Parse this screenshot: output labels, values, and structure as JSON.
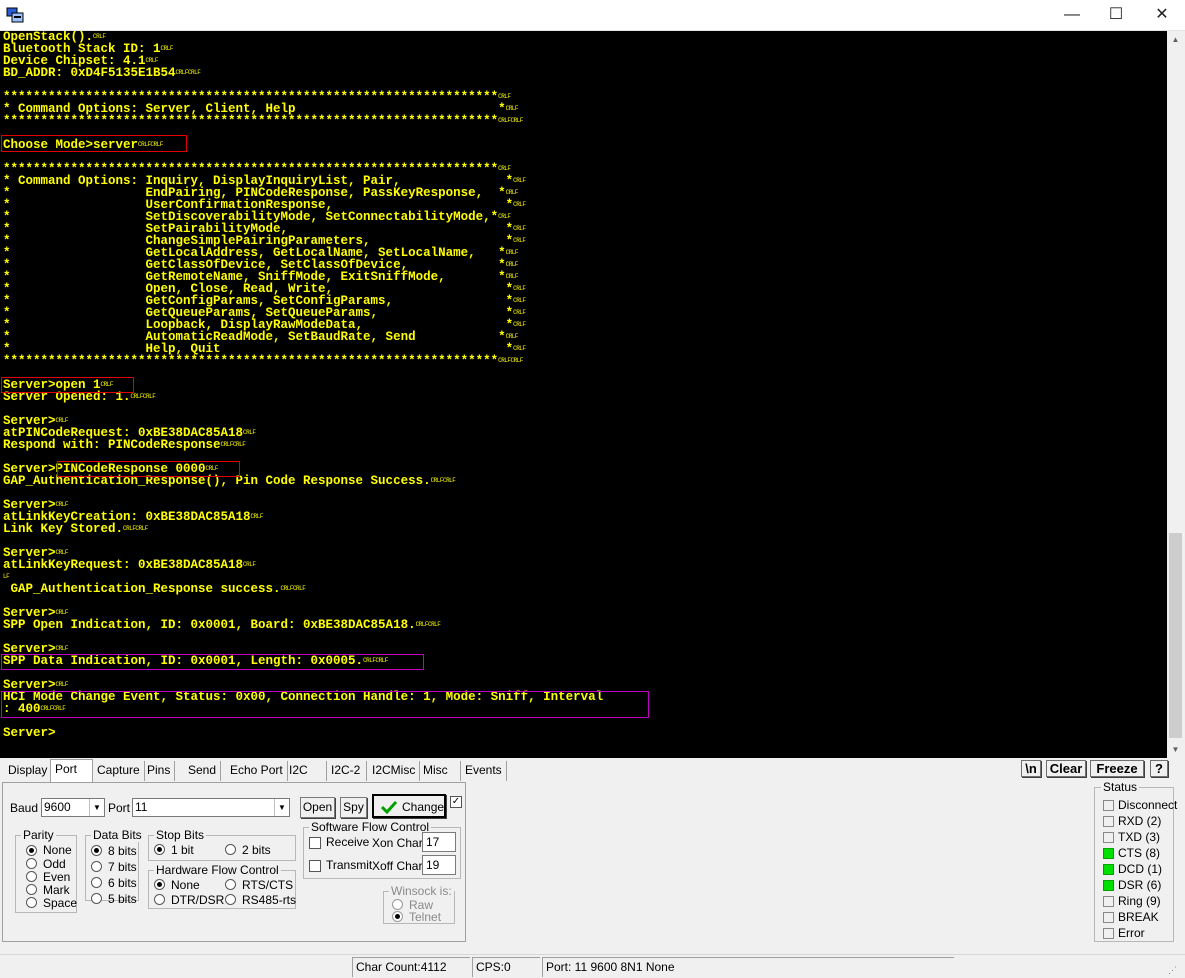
{
  "window": {
    "app_icon": "terminal-app-icon",
    "minimize": "—",
    "maximize": "☐",
    "close": "✕"
  },
  "terminal": {
    "text_color": "#ffff00",
    "background": "#000000",
    "crlf": "CRLF",
    "lines": [
      {
        "t": "OpenStack().",
        "e": "CRLF"
      },
      {
        "t": "Bluetooth Stack ID: 1",
        "e": "CRLF"
      },
      {
        "t": "Device Chipset: 4.1",
        "e": "CRLF"
      },
      {
        "t": "BD_ADDR: 0xD4F5135E1B54",
        "e": "CRLFCRLF"
      },
      {
        "t": "",
        "e": ""
      },
      {
        "t": "******************************************************************",
        "e": "CRLF"
      },
      {
        "t": "* Command Options: Server, Client, Help                           *",
        "e": "CRLF"
      },
      {
        "t": "******************************************************************",
        "e": "CRLFCRLF"
      },
      {
        "t": "",
        "e": ""
      },
      {
        "t": "Choose Mode>server",
        "e": "CRLFCRLF"
      },
      {
        "t": "",
        "e": ""
      },
      {
        "t": "******************************************************************",
        "e": "CRLF"
      },
      {
        "t": "* Command Options: Inquiry, DisplayInquiryList, Pair,              *",
        "e": "CRLF"
      },
      {
        "t": "*                  EndPairing, PINCodeResponse, PassKeyResponse,  *",
        "e": "CRLF"
      },
      {
        "t": "*                  UserConfirmationResponse,                       *",
        "e": "CRLF"
      },
      {
        "t": "*                  SetDiscoverabilityMode, SetConnectabilityMode,*",
        "e": "CRLF"
      },
      {
        "t": "*                  SetPairabilityMode,                             *",
        "e": "CRLF"
      },
      {
        "t": "*                  ChangeSimplePairingParameters,                  *",
        "e": "CRLF"
      },
      {
        "t": "*                  GetLocalAddress, GetLocalName, SetLocalName,   *",
        "e": "CRLF"
      },
      {
        "t": "*                  GetClassOfDevice, SetClassOfDevice,            *",
        "e": "CRLF"
      },
      {
        "t": "*                  GetRemoteName, SniffMode, ExitSniffMode,       *",
        "e": "CRLF"
      },
      {
        "t": "*                  Open, Close, Read, Write,                       *",
        "e": "CRLF"
      },
      {
        "t": "*                  GetConfigParams, SetConfigParams,               *",
        "e": "CRLF"
      },
      {
        "t": "*                  GetQueueParams, SetQueueParams,                 *",
        "e": "CRLF"
      },
      {
        "t": "*                  Loopback, DisplayRawModeData,                   *",
        "e": "CRLF"
      },
      {
        "t": "*                  AutomaticReadMode, SetBaudRate, Send           *",
        "e": "CRLF"
      },
      {
        "t": "*                  Help, Quit                                      *",
        "e": "CRLF"
      },
      {
        "t": "******************************************************************",
        "e": "CRLFCRLF"
      },
      {
        "t": "",
        "e": ""
      },
      {
        "t": "Server>open 1",
        "e": "CRLF"
      },
      {
        "t": "Server Opened: 1.",
        "e": "CRLFCRLF"
      },
      {
        "t": "",
        "e": ""
      },
      {
        "t": "Server>",
        "e": "CRLF"
      },
      {
        "t": "atPINCodeRequest: 0xBE38DAC85A18",
        "e": "CRLF"
      },
      {
        "t": "Respond with: PINCodeResponse",
        "e": "CRLFCRLF"
      },
      {
        "t": "",
        "e": ""
      },
      {
        "t": "Server>PINCodeResponse 0000",
        "e": "CRLF"
      },
      {
        "t": "GAP_Authentication_Response(), Pin Code Response Success.",
        "e": "CRLFCRLF"
      },
      {
        "t": "",
        "e": ""
      },
      {
        "t": "Server>",
        "e": "CRLF"
      },
      {
        "t": "atLinkKeyCreation: 0xBE38DAC85A18",
        "e": "CRLF"
      },
      {
        "t": "Link Key Stored.",
        "e": "CRLFCRLF"
      },
      {
        "t": "",
        "e": ""
      },
      {
        "t": "Server>",
        "e": "CRLF"
      },
      {
        "t": "atLinkKeyRequest: 0xBE38DAC85A18",
        "e": "CRLF"
      },
      {
        "t": "",
        "e": "LF"
      },
      {
        "t": " GAP_Authentication_Response success.",
        "e": "CRLFCRLF"
      },
      {
        "t": "",
        "e": ""
      },
      {
        "t": "Server>",
        "e": "CRLF"
      },
      {
        "t": "SPP Open Indication, ID: 0x0001, Board: 0xBE38DAC85A18.",
        "e": "CRLFCRLF"
      },
      {
        "t": "",
        "e": ""
      },
      {
        "t": "Server>",
        "e": "CRLF"
      },
      {
        "t": "SPP Data Indication, ID: 0x0001, Length: 0x0005.",
        "e": "CRLFCRLF"
      },
      {
        "t": "",
        "e": ""
      },
      {
        "t": "Server>",
        "e": "CRLF"
      },
      {
        "t": "HCI Mode Change Event, Status: 0x00, Connection Handle: 1, Mode: Sniff, Interval",
        "e": ""
      },
      {
        "t": ": 400",
        "e": "CRLFCRLF"
      },
      {
        "t": "",
        "e": ""
      },
      {
        "t": "Server>",
        "e": ""
      }
    ]
  },
  "tabs": [
    "Display",
    "Port",
    "Capture",
    "Pins",
    "Send",
    "Echo Port",
    "I2C",
    "I2C-2",
    "I2CMisc",
    "Misc",
    "Events"
  ],
  "active_tab": "Port",
  "toolbar": {
    "newline": "\\n",
    "clear": "Clear",
    "freeze": "Freeze",
    "help": "?"
  },
  "port_panel": {
    "baud_label": "Baud",
    "baud_value": "9600",
    "port_label": "Port",
    "port_value": "11",
    "open": "Open",
    "spy": "Spy",
    "change": "Change",
    "change_checked": true,
    "parity": {
      "title": "Parity",
      "options": [
        "None",
        "Odd",
        "Even",
        "Mark",
        "Space"
      ],
      "selected": "None"
    },
    "data_bits": {
      "title": "Data Bits",
      "options": [
        "8 bits",
        "7 bits",
        "6 bits",
        "5 bits"
      ],
      "selected": "8 bits"
    },
    "stop_bits": {
      "title": "Stop Bits",
      "options": [
        "1 bit",
        "2 bits"
      ],
      "selected": "1 bit"
    },
    "hw_flow": {
      "title": "Hardware Flow Control",
      "options": [
        "None",
        "RTS/CTS",
        "DTR/DSR",
        "RS485-rts"
      ],
      "selected": "None"
    },
    "sw_flow": {
      "title": "Software Flow Control",
      "receive": "Receive",
      "transmit": "Transmit",
      "xon_label": "Xon Char:",
      "xon_value": "17",
      "xoff_label": "Xoff Char:",
      "xoff_value": "19"
    },
    "winsock": {
      "title": "Winsock is:",
      "options": [
        "Raw",
        "Telnet"
      ],
      "selected": "Telnet"
    }
  },
  "status_panel": {
    "title": "Status",
    "on_color": "#00e000",
    "items": [
      {
        "label": "Disconnect",
        "on": false
      },
      {
        "label": "RXD (2)",
        "on": false
      },
      {
        "label": "TXD (3)",
        "on": false
      },
      {
        "label": "CTS (8)",
        "on": true
      },
      {
        "label": "DCD (1)",
        "on": true
      },
      {
        "label": "DSR (6)",
        "on": true
      },
      {
        "label": "Ring (9)",
        "on": false
      },
      {
        "label": "BREAK",
        "on": false
      },
      {
        "label": "Error",
        "on": false
      }
    ]
  },
  "statusbar": {
    "char_count": "Char Count:4112",
    "cps": "CPS:0",
    "port_info": "Port: 11 9600 8N1 None"
  }
}
